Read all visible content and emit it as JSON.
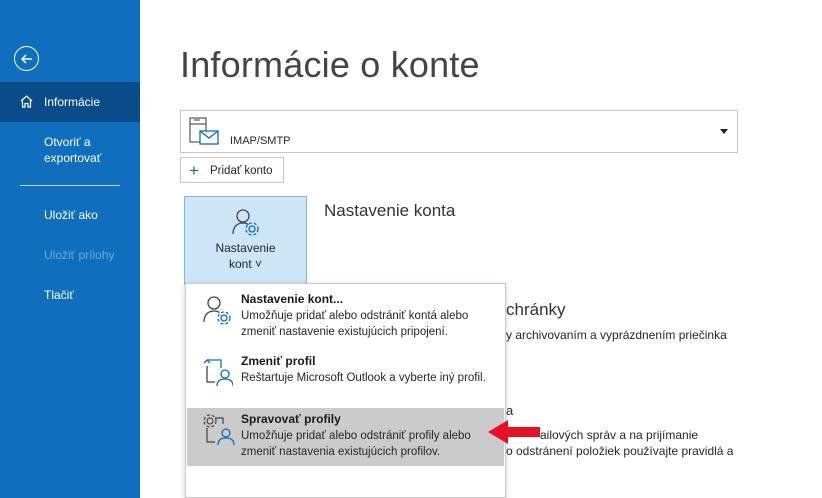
{
  "sidebar": {
    "items": [
      {
        "label": "Informácie"
      },
      {
        "label": "Otvoriť a exportovať"
      },
      {
        "label": "Uložiť ako"
      },
      {
        "label": "Uložiť prílohy"
      },
      {
        "label": "Tlačiť"
      }
    ],
    "open_export_line1": "Otvoriť a",
    "open_export_line2": "exportovať"
  },
  "main": {
    "title": "Informácie o konte",
    "account_selector": {
      "value": "IMAP/SMTP"
    },
    "add_account_label": "Pridať konto",
    "account_settings_button": {
      "line1": "Nastavenie",
      "line2": "kont ˅"
    },
    "section_heading": "Nastavenie konta",
    "background_fragments": {
      "mailbox_heading_frag": "chránky",
      "mailbox_desc_frag": "y archivovaním a vyprázdnením priečinka",
      "rules_frag1": "a",
      "rules_frag2": "ailových správ a na prijímanie",
      "rules_frag3": "o odstránení položiek používajte pravidlá a"
    }
  },
  "menu": {
    "items": [
      {
        "title": "Nastavenie kont...",
        "desc": "Umožňuje pridať alebo odstrániť kontá alebo zmeniť nastavenie existujúcich pripojení.",
        "icon": "account-settings-icon"
      },
      {
        "title": "Zmeniť profil",
        "desc": "Reštartuje Microsoft Outlook a vyberte iný profil.",
        "icon": "change-profile-icon"
      },
      {
        "title": "Spravovať profily",
        "desc": "Umožňuje pridať alebo odstrániť profily alebo zmeniť nastavenia existujúcich profilov.",
        "icon": "manage-profiles-icon"
      }
    ]
  },
  "colors": {
    "sidebar": "#106ebe",
    "sidebar_active": "#094c89",
    "button_selected": "#cde6f7",
    "menu_hover": "#cbcbcb",
    "annotation_arrow": "#e81123"
  }
}
